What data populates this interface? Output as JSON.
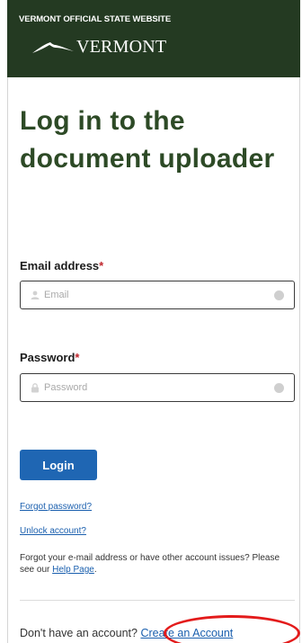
{
  "header": {
    "official_label": "VERMONT OFFICIAL STATE WEBSITE",
    "logo_text": "VERMONT",
    "logo_icon": "mountain-logo-icon"
  },
  "page": {
    "title": "Log in to the document uploader"
  },
  "form": {
    "email": {
      "label": "Email address",
      "required_mark": "*",
      "placeholder": "Email",
      "icon": "user-icon"
    },
    "password": {
      "label": "Password",
      "required_mark": "*",
      "placeholder": "Password",
      "icon": "lock-icon"
    },
    "login_label": "Login"
  },
  "links": {
    "forgot_password": "Forgot password?",
    "unlock_account": "Unlock account?",
    "help_text_prefix": "Forgot your e-mail address or have other account issues? Please see our ",
    "help_page_link": "Help Page",
    "help_text_suffix": ".",
    "no_account_text": "Don't have an account?",
    "create_account_link": "Create an Account"
  },
  "colors": {
    "header_bg": "#243a22",
    "title_color": "#2d4a26",
    "primary_button": "#1f66b3",
    "link": "#1a5fae",
    "required": "#c0262d",
    "annotation": "#e31b1b"
  }
}
